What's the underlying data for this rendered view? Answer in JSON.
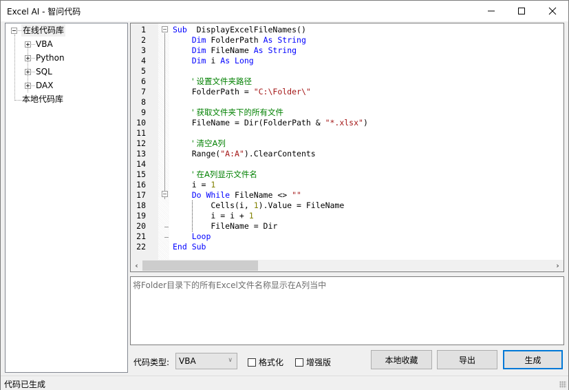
{
  "window": {
    "title": "Excel AI - 智问代码",
    "controls": {
      "minimize": "minimize-icon",
      "maximize": "maximize-icon",
      "close": "close-icon"
    }
  },
  "tree": {
    "root_online": "在线代码库",
    "children": [
      "VBA",
      "Python",
      "SQL",
      "DAX"
    ],
    "root_local": "本地代码库"
  },
  "editor": {
    "lines": [
      {
        "n": "1",
        "tokens": [
          [
            "kw",
            "Sub"
          ],
          [
            "",
            "  DisplayExcelFileNames()"
          ]
        ]
      },
      {
        "n": "2",
        "tokens": [
          [
            "",
            "    "
          ],
          [
            "kw",
            "Dim"
          ],
          [
            "",
            " FolderPath "
          ],
          [
            "kw",
            "As String"
          ]
        ]
      },
      {
        "n": "3",
        "tokens": [
          [
            "",
            "    "
          ],
          [
            "kw",
            "Dim"
          ],
          [
            "",
            " FileName "
          ],
          [
            "kw",
            "As String"
          ]
        ]
      },
      {
        "n": "4",
        "tokens": [
          [
            "",
            "    "
          ],
          [
            "kw",
            "Dim"
          ],
          [
            "",
            " i "
          ],
          [
            "kw",
            "As Long"
          ]
        ]
      },
      {
        "n": "5",
        "tokens": []
      },
      {
        "n": "6",
        "tokens": [
          [
            "",
            "    "
          ],
          [
            "cmt",
            "' 设置文件夹路径"
          ]
        ]
      },
      {
        "n": "7",
        "tokens": [
          [
            "",
            "    FolderPath = "
          ],
          [
            "str",
            "\"C:\\Folder\\\""
          ]
        ]
      },
      {
        "n": "8",
        "tokens": []
      },
      {
        "n": "9",
        "tokens": [
          [
            "",
            "    "
          ],
          [
            "cmt",
            "' 获取文件夹下的所有文件"
          ]
        ]
      },
      {
        "n": "10",
        "tokens": [
          [
            "",
            "    FileName = Dir(FolderPath & "
          ],
          [
            "str",
            "\"*.xlsx\""
          ],
          [
            "",
            ")"
          ]
        ]
      },
      {
        "n": "11",
        "tokens": []
      },
      {
        "n": "12",
        "tokens": [
          [
            "",
            "    "
          ],
          [
            "cmt",
            "' 清空A列"
          ]
        ]
      },
      {
        "n": "13",
        "tokens": [
          [
            "",
            "    Range("
          ],
          [
            "str",
            "\"A:A\""
          ],
          [
            "",
            ").ClearContents"
          ]
        ]
      },
      {
        "n": "14",
        "tokens": []
      },
      {
        "n": "15",
        "tokens": [
          [
            "",
            "    "
          ],
          [
            "cmt",
            "' 在A列显示文件名"
          ]
        ]
      },
      {
        "n": "16",
        "tokens": [
          [
            "",
            "    i = "
          ],
          [
            "num",
            "1"
          ]
        ]
      },
      {
        "n": "17",
        "tokens": [
          [
            "",
            "    "
          ],
          [
            "kw",
            "Do While"
          ],
          [
            "",
            " FileName <> "
          ],
          [
            "str",
            "\"\""
          ]
        ]
      },
      {
        "n": "18",
        "tokens": [
          [
            "",
            "        Cells(i, "
          ],
          [
            "num",
            "1"
          ],
          [
            "",
            ").Value = FileName"
          ]
        ]
      },
      {
        "n": "19",
        "tokens": [
          [
            "",
            "        i = i + "
          ],
          [
            "num",
            "1"
          ]
        ]
      },
      {
        "n": "20",
        "tokens": [
          [
            "",
            "        FileName = Dir"
          ]
        ]
      },
      {
        "n": "21",
        "tokens": [
          [
            "",
            "    "
          ],
          [
            "kw",
            "Loop"
          ]
        ]
      },
      {
        "n": "22",
        "tokens": [
          [
            "kw",
            "End Sub"
          ]
        ]
      }
    ],
    "scroll_left_icon": "‹",
    "scroll_right_icon": "›"
  },
  "prompt": {
    "text": "将Folder目录下的所有Excel文件名称显示在A列当中"
  },
  "controls": {
    "code_type_label": "代码类型:",
    "code_type_value": "VBA",
    "format_label": "格式化",
    "format_checked": false,
    "enhanced_label": "增强版",
    "enhanced_checked": false,
    "save_local_label": "本地收藏",
    "export_label": "导出",
    "generate_label": "生成"
  },
  "status": {
    "text": "代码已生成"
  },
  "colors": {
    "keyword": "#0000ff",
    "string": "#a31515",
    "comment": "#008000",
    "number": "#808000",
    "accent": "#0078d7"
  }
}
